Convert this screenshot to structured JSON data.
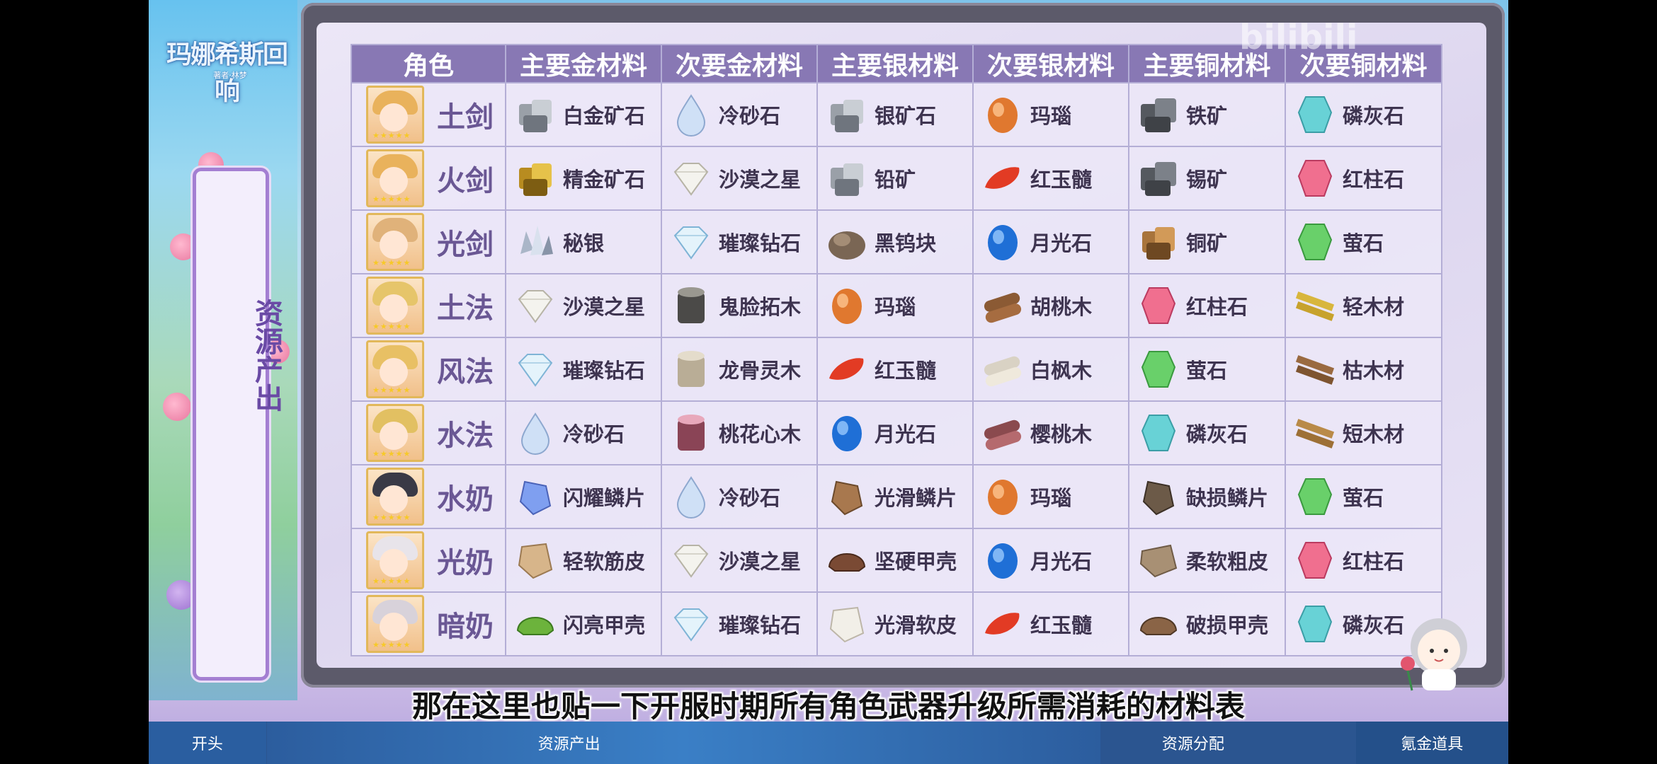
{
  "watermark": "bilibili",
  "logo": {
    "title": "玛娜希斯回响",
    "subtitle": "著者·林梦"
  },
  "side_label": "资源产出",
  "subtitle_text": "那在这里也贴一下开服时期所有角色武器升级所需消耗的材料表",
  "table": {
    "headers": [
      "角色",
      "主要金材料",
      "次要金材料",
      "主要银材料",
      "次要银材料",
      "主要铜材料",
      "次要铜材料"
    ],
    "rows": [
      {
        "role": "土剑",
        "cells": [
          {
            "name": "白金矿石",
            "icon": "silver-ore-icon"
          },
          {
            "name": "冷砂石",
            "icon": "crystal-drop-icon"
          },
          {
            "name": "银矿石",
            "icon": "silver-ore-icon"
          },
          {
            "name": "玛瑙",
            "icon": "orange-egg-icon"
          },
          {
            "name": "铁矿",
            "icon": "dark-ore-icon"
          },
          {
            "name": "磷灰石",
            "icon": "cyan-gem-icon"
          }
        ]
      },
      {
        "role": "火剑",
        "cells": [
          {
            "name": "精金矿石",
            "icon": "gold-ore-icon"
          },
          {
            "name": "沙漠之星",
            "icon": "diamond-icon"
          },
          {
            "name": "铅矿",
            "icon": "silver-ore-icon"
          },
          {
            "name": "红玉髓",
            "icon": "red-pebble-icon"
          },
          {
            "name": "锡矿",
            "icon": "dark-ore-icon"
          },
          {
            "name": "红柱石",
            "icon": "pink-gem-icon"
          }
        ]
      },
      {
        "role": "光剑",
        "cells": [
          {
            "name": "秘银",
            "icon": "silver-cluster-icon"
          },
          {
            "name": "璀璨钻石",
            "icon": "blue-diamond-icon"
          },
          {
            "name": "黑钨块",
            "icon": "brown-rock-icon"
          },
          {
            "name": "月光石",
            "icon": "blue-egg-icon"
          },
          {
            "name": "铜矿",
            "icon": "copper-ore-icon"
          },
          {
            "name": "萤石",
            "icon": "green-gem-icon"
          }
        ]
      },
      {
        "role": "土法",
        "cells": [
          {
            "name": "沙漠之星",
            "icon": "diamond-icon"
          },
          {
            "name": "鬼脸拓木",
            "icon": "dark-stump-icon"
          },
          {
            "name": "玛瑙",
            "icon": "orange-egg-icon"
          },
          {
            "name": "胡桃木",
            "icon": "log-icon"
          },
          {
            "name": "红柱石",
            "icon": "pink-gem-icon"
          },
          {
            "name": "轻木材",
            "icon": "yellow-planks-icon"
          }
        ]
      },
      {
        "role": "风法",
        "cells": [
          {
            "name": "璀璨钻石",
            "icon": "blue-diamond-icon"
          },
          {
            "name": "龙骨灵木",
            "icon": "pale-stump-icon"
          },
          {
            "name": "红玉髓",
            "icon": "red-pebble-icon"
          },
          {
            "name": "白枫木",
            "icon": "white-log-icon"
          },
          {
            "name": "萤石",
            "icon": "green-gem-icon"
          },
          {
            "name": "枯木材",
            "icon": "brown-planks-icon"
          }
        ]
      },
      {
        "role": "水法",
        "cells": [
          {
            "name": "冷砂石",
            "icon": "crystal-drop-icon"
          },
          {
            "name": "桃花心木",
            "icon": "pink-stump-icon"
          },
          {
            "name": "月光石",
            "icon": "blue-egg-icon"
          },
          {
            "name": "樱桃木",
            "icon": "cherry-log-icon"
          },
          {
            "name": "磷灰石",
            "icon": "cyan-gem-icon"
          },
          {
            "name": "短木材",
            "icon": "short-planks-icon"
          }
        ]
      },
      {
        "role": "水奶",
        "cells": [
          {
            "name": "闪耀鳞片",
            "icon": "blue-scale-icon"
          },
          {
            "name": "冷砂石",
            "icon": "crystal-drop-icon"
          },
          {
            "name": "光滑鳞片",
            "icon": "brown-scale-icon"
          },
          {
            "name": "玛瑙",
            "icon": "orange-egg-icon"
          },
          {
            "name": "缺损鳞片",
            "icon": "dark-scale-icon"
          },
          {
            "name": "萤石",
            "icon": "green-gem-icon"
          }
        ]
      },
      {
        "role": "光奶",
        "cells": [
          {
            "name": "轻软筋皮",
            "icon": "tan-hide-icon"
          },
          {
            "name": "沙漠之星",
            "icon": "diamond-icon"
          },
          {
            "name": "坚硬甲壳",
            "icon": "brown-shell-icon"
          },
          {
            "name": "月光石",
            "icon": "blue-egg-icon"
          },
          {
            "name": "柔软粗皮",
            "icon": "fur-hide-icon"
          },
          {
            "name": "红柱石",
            "icon": "pink-gem-icon"
          }
        ]
      },
      {
        "role": "暗奶",
        "cells": [
          {
            "name": "闪亮甲壳",
            "icon": "green-shell-icon"
          },
          {
            "name": "璀璨钻石",
            "icon": "blue-diamond-icon"
          },
          {
            "name": "光滑软皮",
            "icon": "white-hide-icon"
          },
          {
            "name": "红玉髓",
            "icon": "red-pebble-icon"
          },
          {
            "name": "破损甲壳",
            "icon": "broken-shell-icon"
          },
          {
            "name": "磷灰石",
            "icon": "cyan-gem-icon"
          }
        ]
      }
    ]
  },
  "chapters": [
    {
      "label": "开头"
    },
    {
      "label": "资源产出"
    },
    {
      "label": "资源分配"
    },
    {
      "label": "氪金道具"
    }
  ],
  "colors": {
    "header_bg": "#8878b4",
    "board": "#5c5a6a",
    "panel_border": "#a47fd2",
    "role_text": "#6a5794"
  }
}
